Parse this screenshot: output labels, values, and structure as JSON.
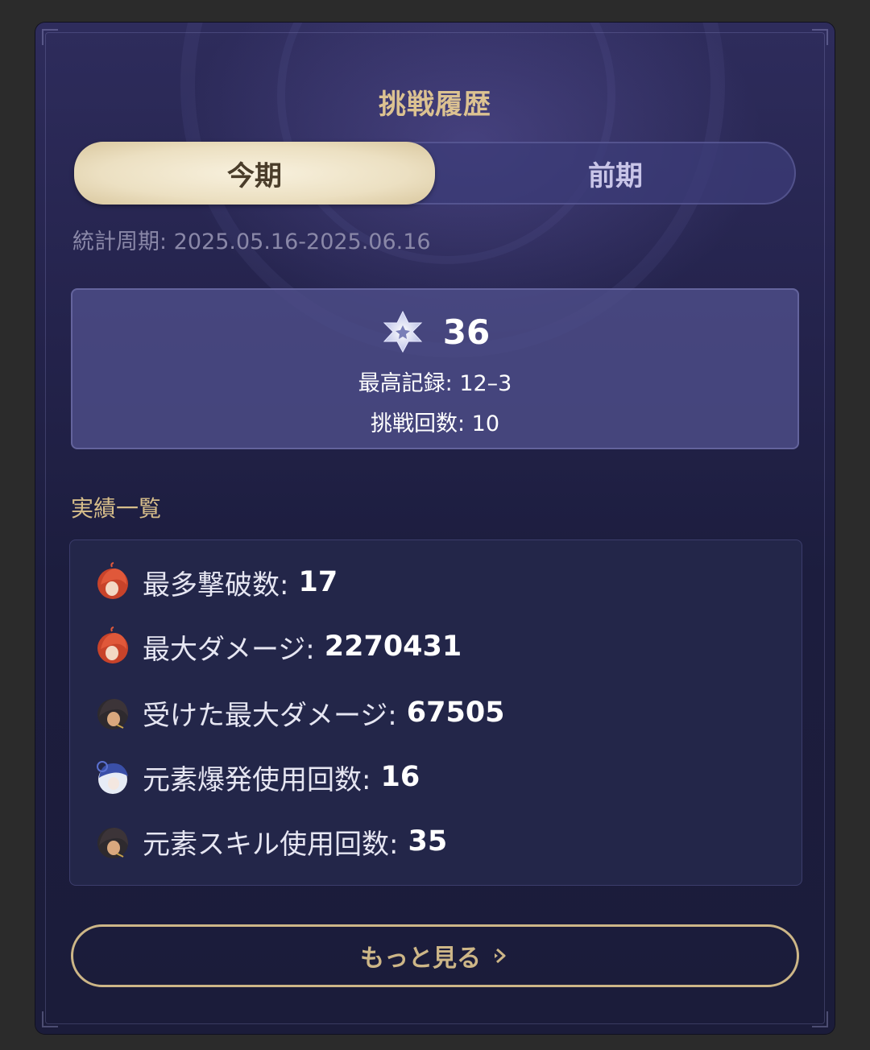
{
  "title": "挑戦履歴",
  "tabs": [
    {
      "label": "今期",
      "active": true
    },
    {
      "label": "前期",
      "active": false
    }
  ],
  "period": "統計周期: 2025.05.16-2025.06.16",
  "summary": {
    "stars": "36",
    "best_record": "最高記録: 12–3",
    "attempts": "挑戦回数: 10",
    "icon": "star-emblem-icon"
  },
  "section_label": "実績一覧",
  "achievements": [
    {
      "label": "最多撃破数:",
      "value": "17",
      "avatar": "red-hair-character-avatar"
    },
    {
      "label": "最大ダメージ:",
      "value": "2270431",
      "avatar": "red-hair-character-avatar"
    },
    {
      "label": "受けた最大ダメージ:",
      "value": "67505",
      "avatar": "dark-hair-character-avatar"
    },
    {
      "label": "元素爆発使用回数:",
      "value": "16",
      "avatar": "white-blue-character-avatar"
    },
    {
      "label": "元素スキル使用回数:",
      "value": "35",
      "avatar": "dark-hair-character-avatar"
    }
  ],
  "more_button": "もっと見る",
  "colors": {
    "accent_gold": "#dcc291",
    "tab_active_bg": "#f3ead3",
    "panel_bg": "#232649"
  }
}
